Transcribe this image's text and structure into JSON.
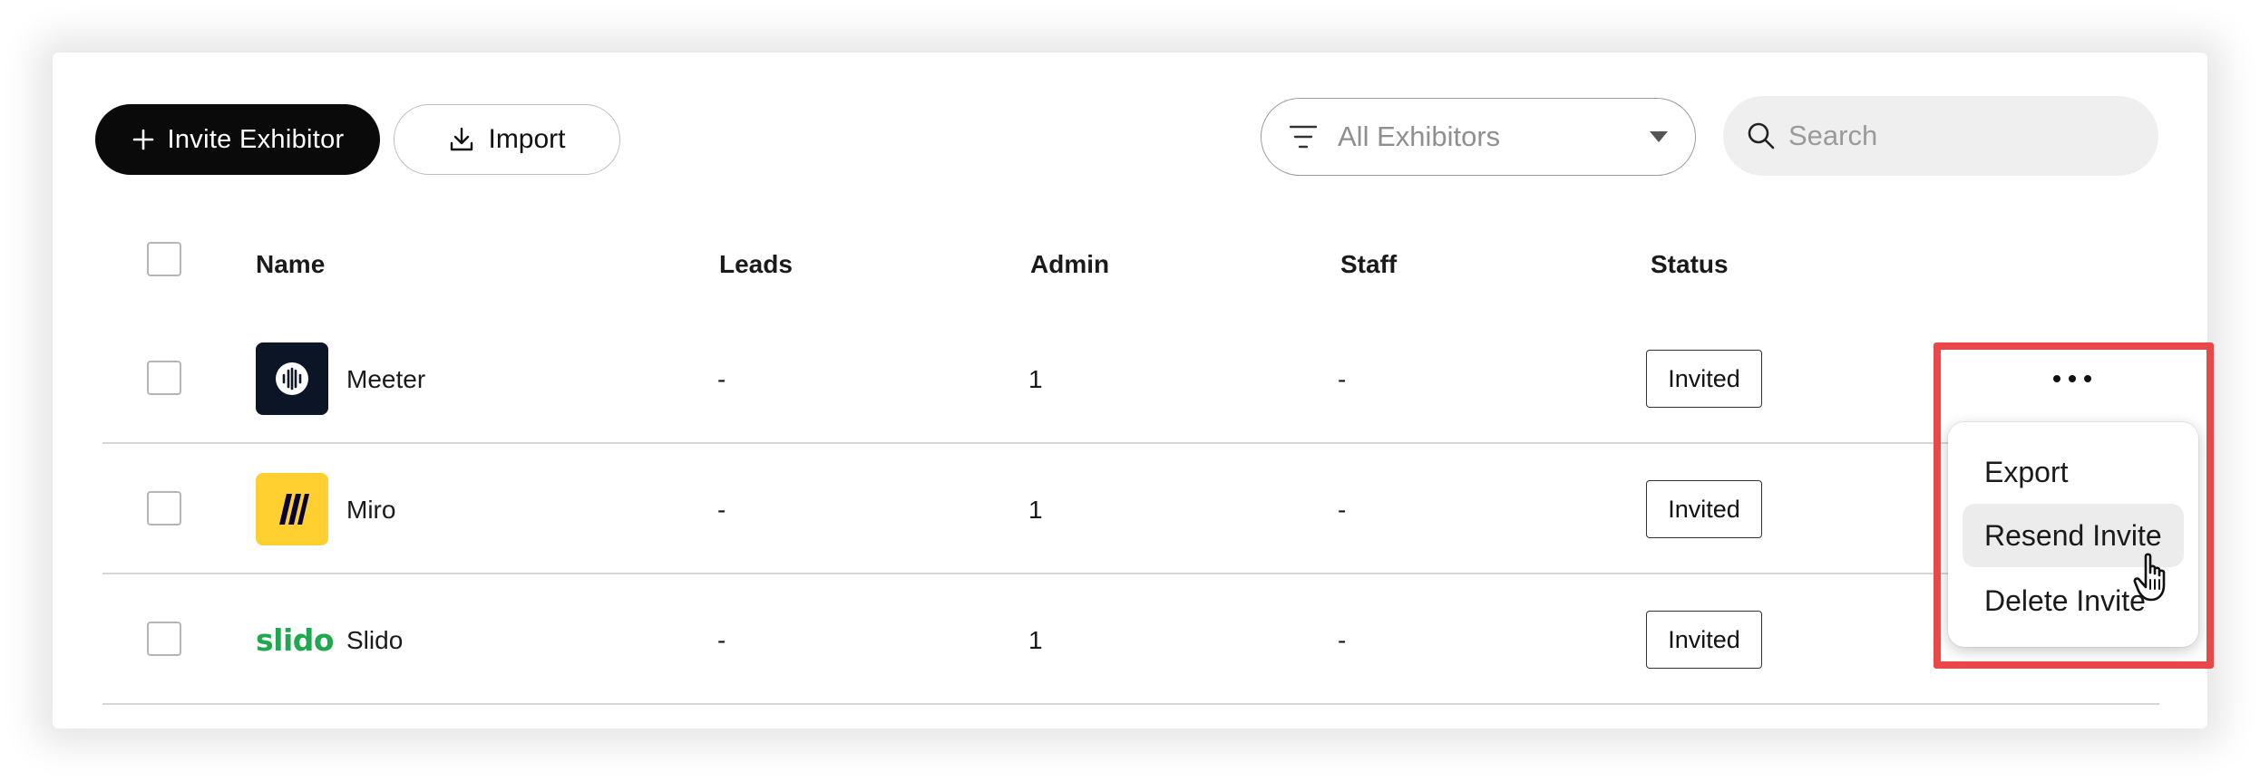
{
  "toolbar": {
    "invite_label": "Invite Exhibitor",
    "import_label": "Import",
    "filter_value": "All Exhibitors",
    "search_placeholder": "Search"
  },
  "table": {
    "headers": {
      "name": "Name",
      "leads": "Leads",
      "admin": "Admin",
      "staff": "Staff",
      "status": "Status"
    },
    "rows": [
      {
        "name": "Meeter",
        "leads": "-",
        "admin": "1",
        "staff": "-",
        "status": "Invited",
        "logo": "meeter-logo"
      },
      {
        "name": "Miro",
        "leads": "-",
        "admin": "1",
        "staff": "-",
        "status": "Invited",
        "logo": "miro-logo"
      },
      {
        "name": "Slido",
        "leads": "-",
        "admin": "1",
        "staff": "-",
        "status": "Invited",
        "logo": "slido",
        "logo_text": "slido"
      }
    ]
  },
  "menu": {
    "items": [
      {
        "label": "Export"
      },
      {
        "label": "Resend Invite"
      },
      {
        "label": "Delete Invite"
      }
    ],
    "hovered_index": 1
  },
  "colors": {
    "primary_button": "#0a0a0a",
    "highlight_border": "#ea4848",
    "slido_green": "#1fa84e",
    "miro_yellow": "#ffd02f",
    "meeter_navy": "#0c1526"
  }
}
